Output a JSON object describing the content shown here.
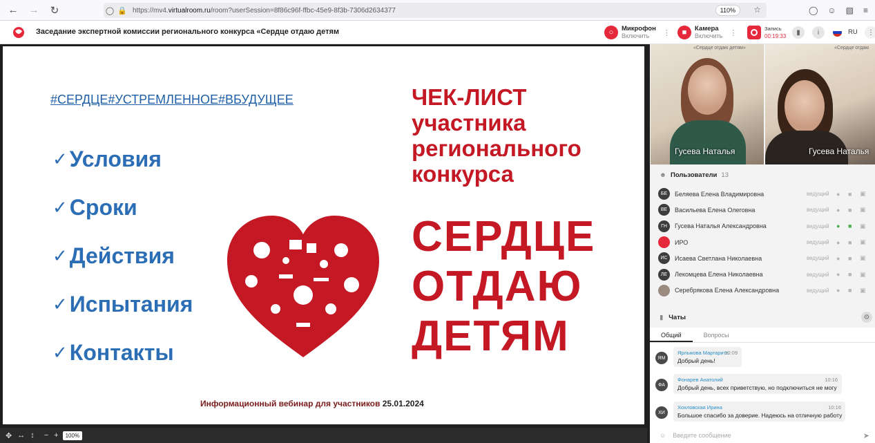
{
  "browser": {
    "url_prefix": "https://mv4.",
    "url_host": "virtualroom.ru",
    "url_rest": "/room?userSession=8f86c96f-ffbc-45e9-8f3b-7306d2634377",
    "zoom": "110%"
  },
  "header": {
    "title": "Заседание экспертной комиссии регионального конкурса «Сердце отдаю детям",
    "mic_label": "Микрофон",
    "mic_action": "Включить",
    "cam_label": "Камера",
    "cam_action": "Включить",
    "rec_label": "Запись",
    "rec_time": "00:19:33",
    "lang": "RU"
  },
  "slide": {
    "hashtag": "#СЕРДЦЕ#УСТРЕМЛЕННОЕ#ВБУДУЩЕЕ",
    "items": [
      "Условия",
      "Сроки",
      "Действия",
      "Испытания",
      "Контакты"
    ],
    "checklist_title": "ЧЕК-ЛИСТ\nучастника\nрегионального\nконкурса",
    "big_title": "СЕРДЦЕ\nОТДАЮ\nДЕТЯМ",
    "footer": "Информационный вебинар для участников",
    "footer_date": "25.01.2024",
    "zoom": "100%"
  },
  "videos": [
    {
      "name": "Гусева Наталья",
      "bg_text": "«Сердце отдаю детям»"
    },
    {
      "name": "Гусева Наталья",
      "bg_text": "«Сердце отдаю"
    }
  ],
  "users": {
    "title": "Пользователи",
    "count": "13",
    "list": [
      {
        "initials": "БЕ",
        "name": "Беляева Елена Владимировна",
        "role": "ведущий",
        "mic_on": false
      },
      {
        "initials": "ВЕ",
        "name": "Васильева Елена Олеговна",
        "role": "ведущий",
        "mic_on": false
      },
      {
        "initials": "ГН",
        "name": "Гусева Наталья Александровна",
        "role": "ведущий",
        "mic_on": true
      },
      {
        "initials": "",
        "name": "ИРО",
        "role": "ведущий",
        "mic_on": false
      },
      {
        "initials": "ИС",
        "name": "Исаева Светлана Николаевна",
        "role": "ведущий",
        "mic_on": false
      },
      {
        "initials": "ЛЕ",
        "name": "Лекомцева Елена Николаевна",
        "role": "ведущий",
        "mic_on": false
      },
      {
        "initials": "",
        "name": "Серебрякова Елена Александровна",
        "role": "ведущий",
        "mic_on": false
      }
    ]
  },
  "chats": {
    "title": "Чаты",
    "tabs": [
      "Общий",
      "Вопросы"
    ],
    "messages": [
      {
        "initials": "ЯМ",
        "author": "Ярлыкова Маргарита",
        "time": "10:09",
        "text": "Добрый день!"
      },
      {
        "initials": "ФА",
        "author": "Фонарев Анатолий",
        "time": "10:16",
        "text": "Добрый день, всех приветствую, но подключиться не могу"
      },
      {
        "initials": "ХИ",
        "author": "Хохловская Ирина",
        "time": "10:16",
        "text": "Большое спасибо за доверие. Надеюсь на отличную работу"
      }
    ],
    "input_placeholder": "Введите сообщение"
  }
}
